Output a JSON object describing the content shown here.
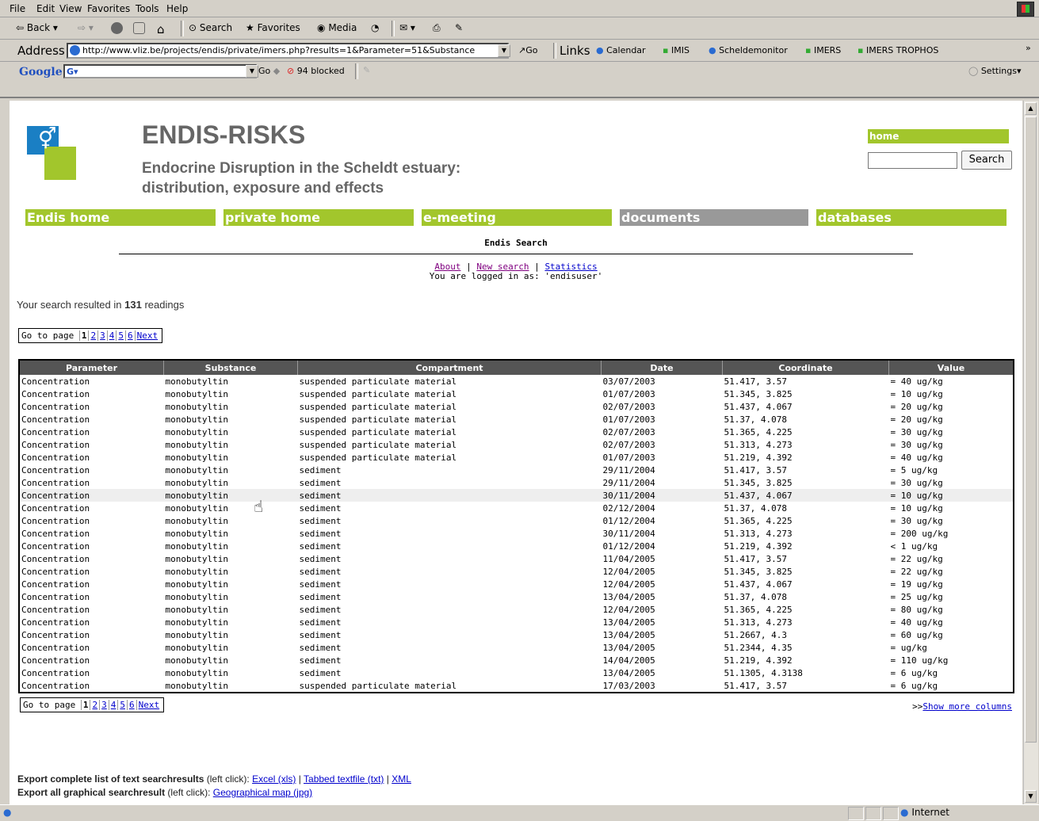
{
  "menu": [
    "File",
    "Edit",
    "View",
    "Favorites",
    "Tools",
    "Help"
  ],
  "toolbar": {
    "back": "Back",
    "search": "Search",
    "favorites": "Favorites",
    "media": "Media"
  },
  "address": {
    "label": "Address",
    "url": "http://www.vliz.be/projects/endis/private/imers.php?results=1&Parameter=51&Substance",
    "go": "Go",
    "links_label": "Links",
    "links": [
      "Calendar",
      "IMIS",
      "Scheldemonitor",
      "IMERS",
      "IMERS TROPHOS"
    ]
  },
  "google": {
    "logo": "Google",
    "go": "Go",
    "blocked": "94 blocked",
    "settings": "Settings"
  },
  "site": {
    "title": "ENDIS-RISKS",
    "subtitle_line1": "Endocrine Disruption in the Scheldt estuary:",
    "subtitle_line2": "distribution, exposure and effects",
    "home_link": "home",
    "search_button": "Search",
    "nav": [
      "Endis home",
      "private home",
      "e-meeting",
      "documents",
      "databases"
    ],
    "section_title": "Endis Search",
    "links": [
      "About",
      "New search",
      "Statistics"
    ],
    "logged_in": "You are logged in as: 'endisuser'"
  },
  "results": {
    "prefix": "Your search resulted in",
    "count": "131",
    "suffix": "readings",
    "pager_label": "Go to page",
    "current_page": "1",
    "pages": [
      "2",
      "3",
      "4",
      "5",
      "6"
    ],
    "next": "Next",
    "show_more": "Show more columns",
    "show_more_prefix": ">>"
  },
  "table": {
    "headers": [
      "Parameter",
      "Substance",
      "Compartment",
      "Date",
      "Coordinate",
      "Value"
    ],
    "rows": [
      [
        "Concentration",
        "monobutyltin",
        "suspended particulate material",
        "03/07/2003",
        "51.417, 3.57",
        "= 40 ug/kg"
      ],
      [
        "Concentration",
        "monobutyltin",
        "suspended particulate material",
        "01/07/2003",
        "51.345, 3.825",
        "= 10 ug/kg"
      ],
      [
        "Concentration",
        "monobutyltin",
        "suspended particulate material",
        "02/07/2003",
        "51.437, 4.067",
        "= 20 ug/kg"
      ],
      [
        "Concentration",
        "monobutyltin",
        "suspended particulate material",
        "01/07/2003",
        "51.37, 4.078",
        "= 20 ug/kg"
      ],
      [
        "Concentration",
        "monobutyltin",
        "suspended particulate material",
        "02/07/2003",
        "51.365, 4.225",
        "= 30 ug/kg"
      ],
      [
        "Concentration",
        "monobutyltin",
        "suspended particulate material",
        "02/07/2003",
        "51.313, 4.273",
        "= 30 ug/kg"
      ],
      [
        "Concentration",
        "monobutyltin",
        "suspended particulate material",
        "01/07/2003",
        "51.219, 4.392",
        "= 40 ug/kg"
      ],
      [
        "Concentration",
        "monobutyltin",
        "sediment",
        "29/11/2004",
        "51.417, 3.57",
        "= 5 ug/kg"
      ],
      [
        "Concentration",
        "monobutyltin",
        "sediment",
        "29/11/2004",
        "51.345, 3.825",
        "= 30 ug/kg"
      ],
      [
        "Concentration",
        "monobutyltin",
        "sediment",
        "30/11/2004",
        "51.437, 4.067",
        "= 10 ug/kg"
      ],
      [
        "Concentration",
        "monobutyltin",
        "sediment",
        "02/12/2004",
        "51.37, 4.078",
        "= 10 ug/kg"
      ],
      [
        "Concentration",
        "monobutyltin",
        "sediment",
        "01/12/2004",
        "51.365, 4.225",
        "= 30 ug/kg"
      ],
      [
        "Concentration",
        "monobutyltin",
        "sediment",
        "30/11/2004",
        "51.313, 4.273",
        "= 200 ug/kg"
      ],
      [
        "Concentration",
        "monobutyltin",
        "sediment",
        "01/12/2004",
        "51.219, 4.392",
        "< 1 ug/kg"
      ],
      [
        "Concentration",
        "monobutyltin",
        "sediment",
        "11/04/2005",
        "51.417, 3.57",
        "= 22 ug/kg"
      ],
      [
        "Concentration",
        "monobutyltin",
        "sediment",
        "12/04/2005",
        "51.345, 3.825",
        "= 22 ug/kg"
      ],
      [
        "Concentration",
        "monobutyltin",
        "sediment",
        "12/04/2005",
        "51.437, 4.067",
        "= 19 ug/kg"
      ],
      [
        "Concentration",
        "monobutyltin",
        "sediment",
        "13/04/2005",
        "51.37, 4.078",
        "= 25 ug/kg"
      ],
      [
        "Concentration",
        "monobutyltin",
        "sediment",
        "12/04/2005",
        "51.365, 4.225",
        "= 80 ug/kg"
      ],
      [
        "Concentration",
        "monobutyltin",
        "sediment",
        "13/04/2005",
        "51.313, 4.273",
        "= 40 ug/kg"
      ],
      [
        "Concentration",
        "monobutyltin",
        "sediment",
        "13/04/2005",
        "51.2667, 4.3",
        "= 60 ug/kg"
      ],
      [
        "Concentration",
        "monobutyltin",
        "sediment",
        "13/04/2005",
        "51.2344, 4.35",
        "= ug/kg"
      ],
      [
        "Concentration",
        "monobutyltin",
        "sediment",
        "14/04/2005",
        "51.219, 4.392",
        "= 110 ug/kg"
      ],
      [
        "Concentration",
        "monobutyltin",
        "sediment",
        "13/04/2005",
        "51.1305, 4.3138",
        "= 6 ug/kg"
      ],
      [
        "Concentration",
        "monobutyltin",
        "suspended particulate material",
        "17/03/2003",
        "51.417, 3.57",
        "= 6 ug/kg"
      ]
    ]
  },
  "export": {
    "text_label": "Export complete list of text searchresults",
    "text_hint": "(left click):",
    "excel": "Excel (xls)",
    "tabbed": "Tabbed textfile (txt)",
    "xml": "XML",
    "graph_label": "Export all graphical searchresult",
    "graph_hint": "(left click):",
    "map": "Geographical map (jpg)"
  },
  "status": {
    "zone": "Internet"
  },
  "colors": {
    "accent_green": "#a2c62c",
    "gray_tab": "#999999",
    "header_gray": "#555555"
  }
}
